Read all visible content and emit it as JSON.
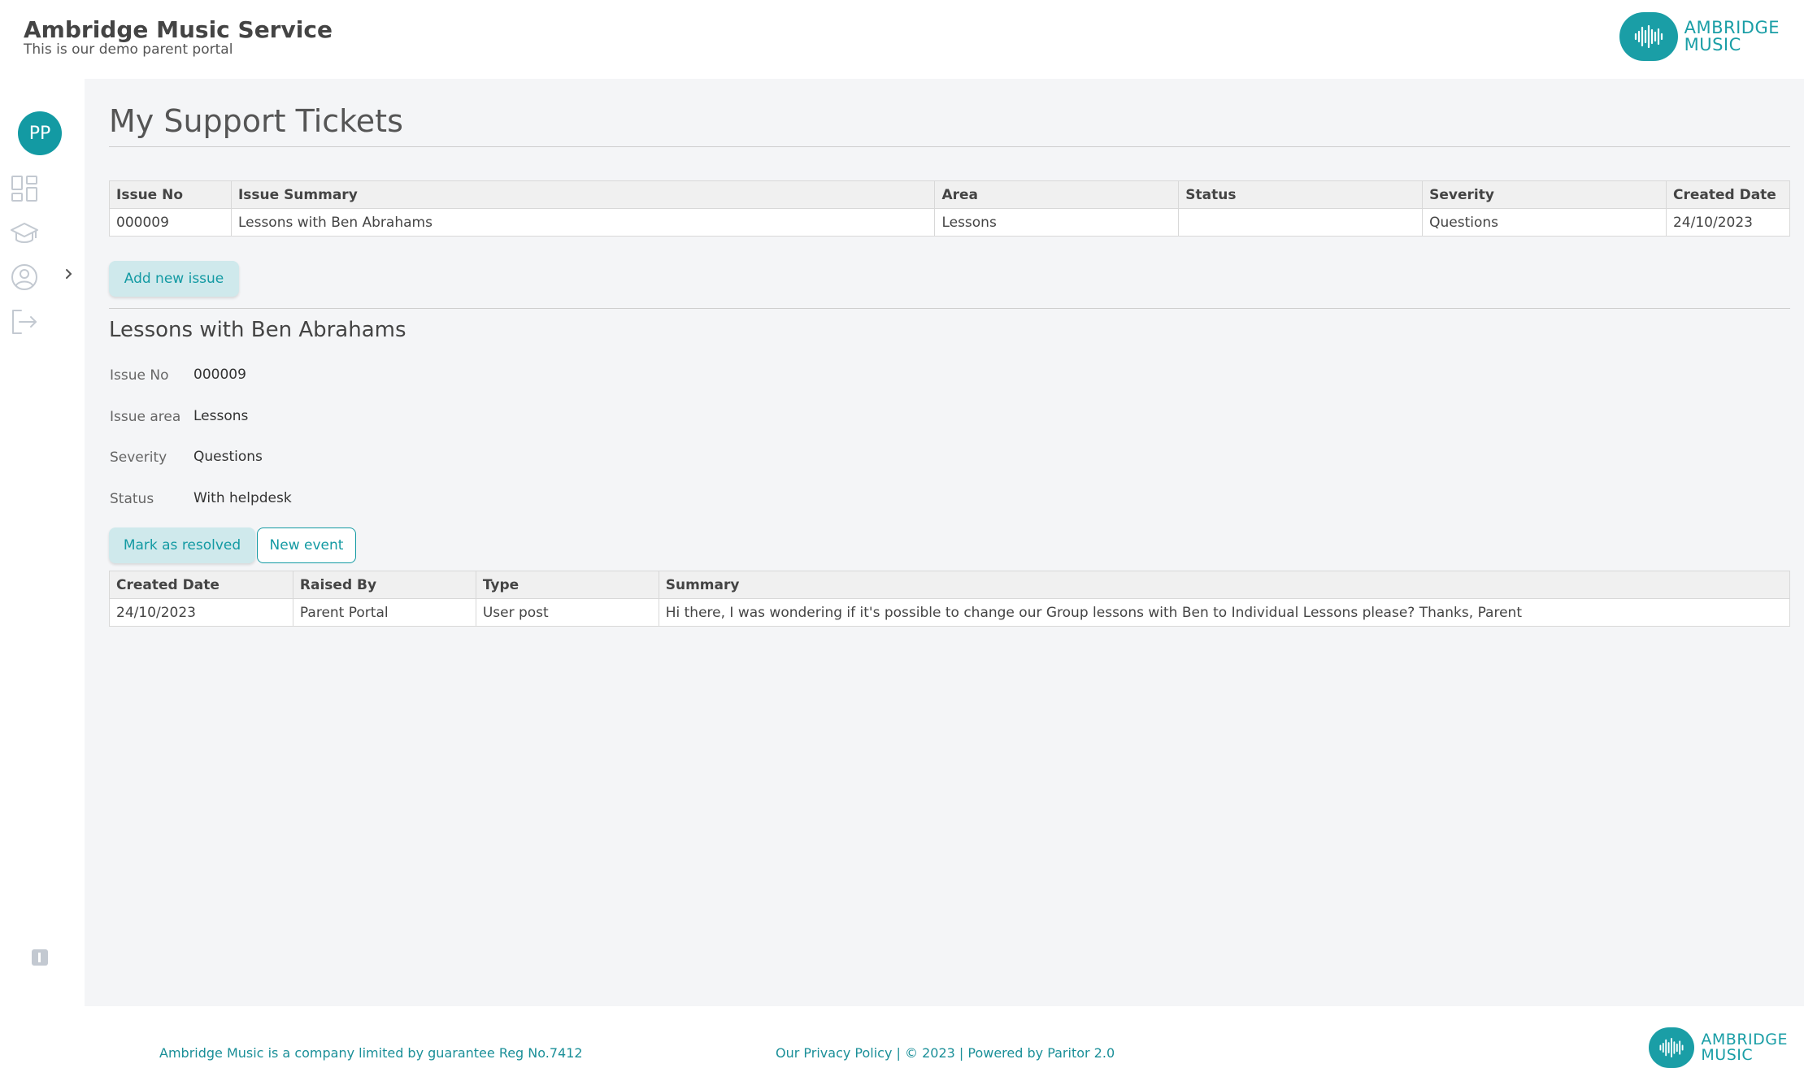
{
  "header": {
    "org_name": "Ambridge Music Service",
    "org_subtitle": "This is our demo parent portal",
    "brand_line1": "AMBRIDGE",
    "brand_line2": "MUSIC"
  },
  "sidebar": {
    "avatar_initials": "PP",
    "items": [
      {
        "icon": "dashboard-icon"
      },
      {
        "icon": "graduation-cap-icon"
      },
      {
        "icon": "user-circle-icon"
      },
      {
        "icon": "logout-icon"
      }
    ]
  },
  "main": {
    "title": "My Support Tickets",
    "tickets_table": {
      "headers": [
        "Issue No",
        "Issue Summary",
        "Area",
        "Status",
        "Severity",
        "Created Date"
      ],
      "rows": [
        [
          "000009",
          "Lessons with Ben Abrahams",
          "Lessons",
          "",
          "Questions",
          "24/10/2023"
        ]
      ]
    },
    "add_issue_label": "Add new issue",
    "detail": {
      "title": "Lessons with Ben Abrahams",
      "fields": [
        {
          "label": "Issue No",
          "value": "000009"
        },
        {
          "label": "Issue area",
          "value": "Lessons"
        },
        {
          "label": "Severity",
          "value": "Questions"
        },
        {
          "label": "Status",
          "value": "With helpdesk"
        }
      ],
      "resolve_label": "Mark as resolved",
      "new_event_label": "New event"
    },
    "events_table": {
      "headers": [
        "Created Date",
        "Raised By",
        "Type",
        "Summary"
      ],
      "rows": [
        [
          "24/10/2023",
          "Parent Portal",
          "User post",
          "Hi there, I was wondering if it's possible to change our Group lessons with Ben to Individual Lessons please? Thanks, Parent"
        ]
      ]
    }
  },
  "footer": {
    "company_note": "Ambridge Music is a company limited by guarantee Reg No.7412",
    "links": "Our Privacy Policy  |  © 2023  |  Powered by Paritor 2.0",
    "brand_line1": "AMBRIDGE",
    "brand_line2": "MUSIC"
  },
  "colors": {
    "accent": "#139aa3",
    "accent_soft": "#cfe9ec",
    "background": "#f4f5f7"
  }
}
